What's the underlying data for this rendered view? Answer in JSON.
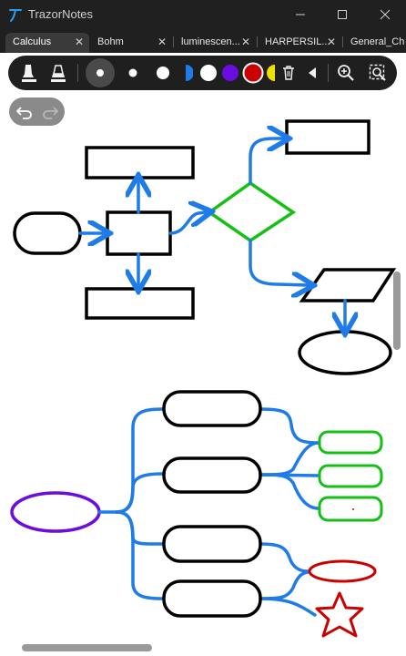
{
  "app": {
    "title": "TrazorNotes"
  },
  "tabs": [
    {
      "label": "Calculus",
      "active": true
    },
    {
      "label": "Bohm",
      "active": false
    },
    {
      "label": "luminescen...",
      "active": false
    },
    {
      "label": "HARPERSIL...",
      "active": false
    },
    {
      "label": "General_Ch",
      "active": false
    }
  ],
  "tab_close_glyph": "✕",
  "toolbar": {
    "tools": [
      "pen-icon",
      "highlighter-icon",
      "stroke-large-icon",
      "stroke-medium-icon",
      "stroke-small-icon",
      "color-palette",
      "delete-icon",
      "collapse-arrow-icon",
      "zoom-icon",
      "lasso-select-icon"
    ],
    "colors": {
      "white": "#ffffff",
      "purple": "#6a0dde",
      "red": "#cc0000",
      "yellow": "#f0e000",
      "blue": "#1e7be8"
    },
    "selected_color": "red"
  },
  "colors": {
    "arrow_blue": "#1e7be8",
    "green": "#14c014",
    "purple": "#6a0dde",
    "red": "#cc0000",
    "black": "#000000"
  }
}
